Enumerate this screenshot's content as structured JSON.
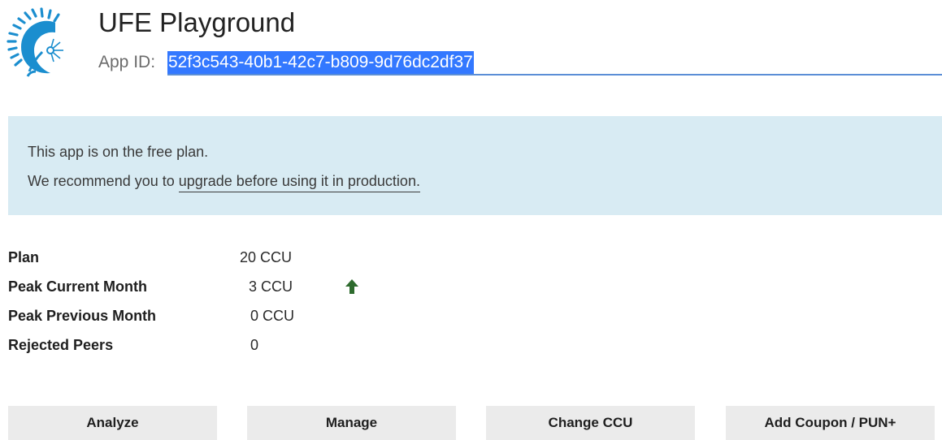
{
  "header": {
    "title": "UFE Playground",
    "app_id_label": "App ID:",
    "app_id_value": "52f3c543-40b1-42c7-b809-9d76dc2df37"
  },
  "notice": {
    "line1": "This app is on the free plan.",
    "line2_prefix": "We recommend you to ",
    "line2_link": "upgrade before using it in production."
  },
  "stats": [
    {
      "label": "Plan",
      "value": "20 CCU"
    },
    {
      "label": "Peak Current Month",
      "value": "3 CCU",
      "trend": "arrow-up-icon"
    },
    {
      "label": "Peak Previous Month",
      "value": "0 CCU"
    },
    {
      "label": "Rejected Peers",
      "value": "0"
    }
  ],
  "buttons": {
    "analyze": "Analyze",
    "manage": "Manage",
    "change_ccu": "Change CCU",
    "add_coupon": "Add Coupon / PUN+"
  },
  "colors": {
    "notice_bg": "#d8ebf3",
    "selection": "#3378ff",
    "input_underline": "#5b8ed6",
    "trend_up": "#2e6b2e",
    "button_bg": "#ebebeb"
  }
}
